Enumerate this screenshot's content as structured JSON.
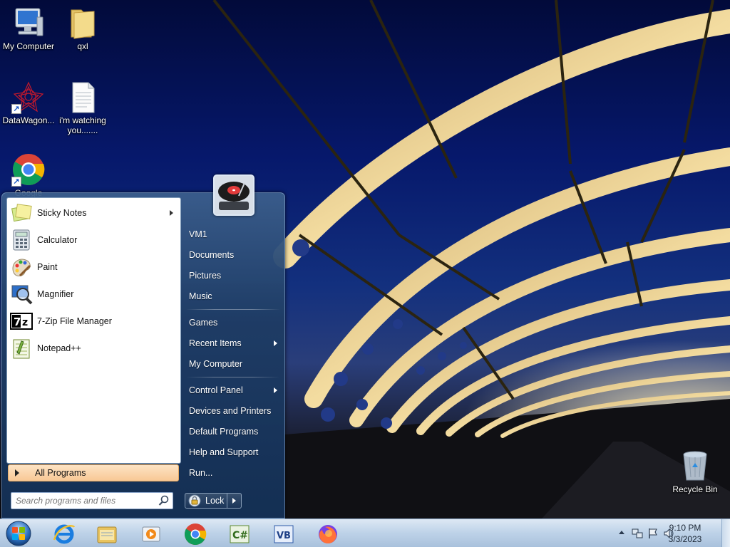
{
  "desktop": {
    "icons": [
      {
        "label": "My Computer"
      },
      {
        "label": "qxl"
      },
      {
        "label": "DataWagon..."
      },
      {
        "label": "i'm watching you......."
      },
      {
        "label": "Google Chrome"
      },
      {
        "label": "Recycle Bin"
      }
    ]
  },
  "start_menu": {
    "programs": [
      {
        "label": "Sticky Notes",
        "icon": "sticky-notes-icon",
        "has_submenu": true
      },
      {
        "label": "Calculator",
        "icon": "calculator-icon"
      },
      {
        "label": "Paint",
        "icon": "paint-icon"
      },
      {
        "label": "Magnifier",
        "icon": "magnifier-icon"
      },
      {
        "label": "7-Zip File Manager",
        "icon": "7zip-icon"
      },
      {
        "label": "Notepad++",
        "icon": "notepadpp-icon"
      }
    ],
    "all_programs": "All Programs",
    "search_placeholder": "Search programs and files",
    "right_items": [
      {
        "label": "VM1"
      },
      {
        "label": "Documents"
      },
      {
        "label": "Pictures"
      },
      {
        "label": "Music"
      },
      {
        "label": "Games"
      },
      {
        "label": "Recent Items",
        "has_submenu": true
      },
      {
        "label": "My Computer"
      },
      {
        "label": "Control Panel",
        "has_submenu": true
      },
      {
        "label": "Devices and Printers"
      },
      {
        "label": "Default Programs"
      },
      {
        "label": "Help and Support"
      },
      {
        "label": "Run..."
      }
    ],
    "lock_label": "Lock"
  },
  "taskbar": {
    "pinned": [
      {
        "name": "internet-explorer"
      },
      {
        "name": "windows-explorer"
      },
      {
        "name": "media-player"
      },
      {
        "name": "google-chrome"
      },
      {
        "name": "visual-csharp"
      },
      {
        "name": "visual-basic"
      },
      {
        "name": "firefox"
      }
    ],
    "clock": {
      "time": "9:10 PM",
      "date": "3/3/2023"
    }
  },
  "colors": {
    "accent_orange": "#f8c895",
    "menu_blue": "#1e3c64",
    "taskbar": "#bdd2e8"
  }
}
